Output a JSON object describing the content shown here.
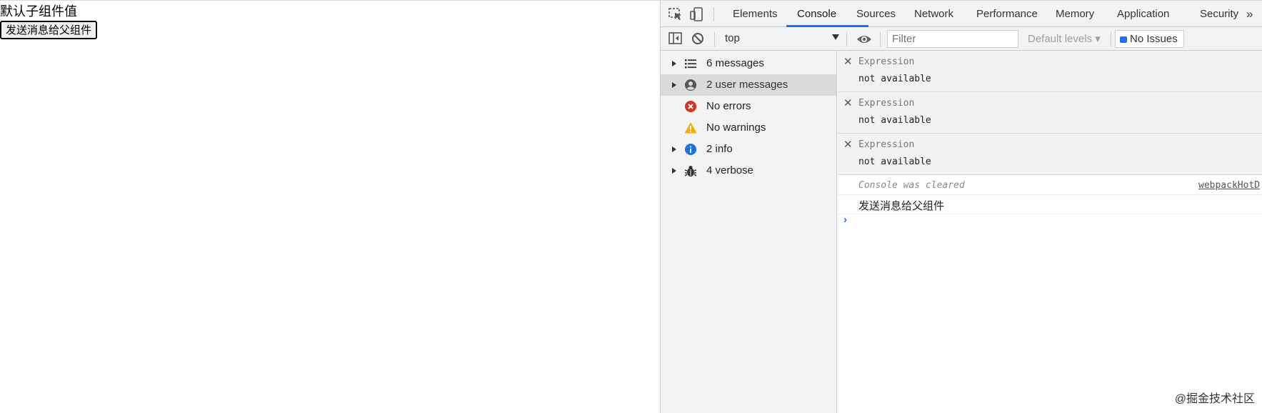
{
  "page": {
    "child_value": "默认子组件值",
    "send_button": "发送消息给父组件"
  },
  "devtools": {
    "tabs": [
      {
        "label": "Elements"
      },
      {
        "label": "Console",
        "active": true
      },
      {
        "label": "Sources"
      },
      {
        "label": "Network"
      },
      {
        "label": "Performance"
      },
      {
        "label": "Memory"
      },
      {
        "label": "Application"
      },
      {
        "label": "Security"
      }
    ],
    "more_tabs": "»",
    "toolbar": {
      "context": "top",
      "filter_placeholder": "Filter",
      "levels": "Default levels ▾",
      "issues": "No Issues"
    },
    "sidebar": [
      {
        "label": "6 messages",
        "icon": "list-icon",
        "expandable": true
      },
      {
        "label": "2 user messages",
        "icon": "user-icon",
        "expandable": true,
        "selected": true
      },
      {
        "label": "No errors",
        "icon": "error-icon",
        "expandable": false
      },
      {
        "label": "No warnings",
        "icon": "warning-icon",
        "expandable": false
      },
      {
        "label": "2 info",
        "icon": "info-icon",
        "expandable": true
      },
      {
        "label": "4 verbose",
        "icon": "bug-icon",
        "expandable": true
      }
    ],
    "expressions": [
      {
        "name": "Expression",
        "value": "not available"
      },
      {
        "name": "Expression",
        "value": "not available"
      },
      {
        "name": "Expression",
        "value": "not available"
      }
    ],
    "messages": {
      "cleared": "Console was cleared",
      "cleared_source": "webpackHotD",
      "log": "发送消息给父组件"
    },
    "prompt": "›"
  },
  "watermark": "@掘金技术社区",
  "colors": {
    "accent": "#1a73e8",
    "error": "#d93025",
    "warning": "#f9ab00",
    "info": "#1a73e8"
  }
}
